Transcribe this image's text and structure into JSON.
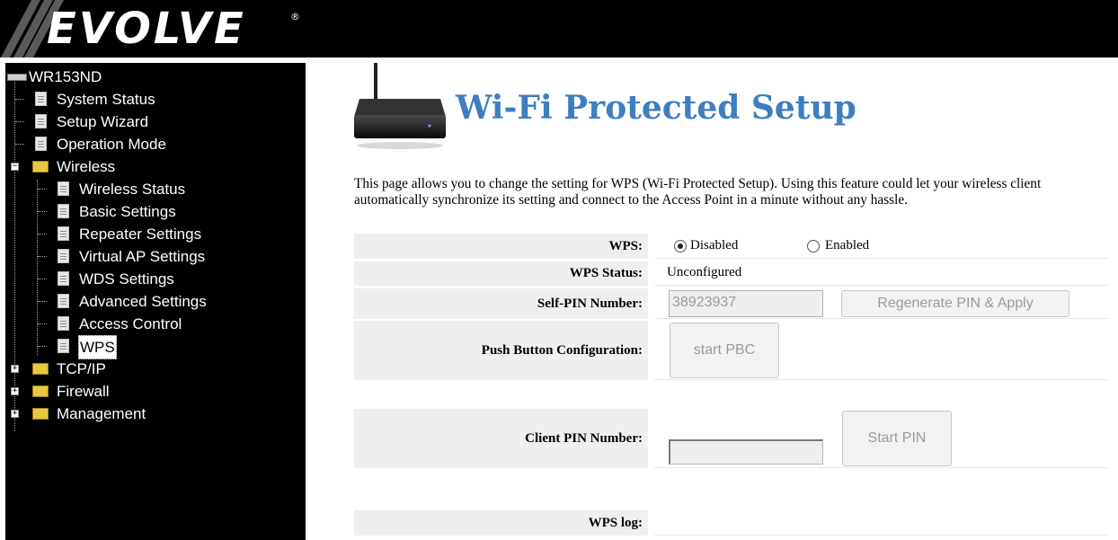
{
  "header": {
    "logo_text": "EVOLVE",
    "logo_mark": "®"
  },
  "sidebar": {
    "root_label": "WR153ND",
    "items": [
      {
        "label": "System Status",
        "icon": "page-icon"
      },
      {
        "label": "Setup Wizard",
        "icon": "page-icon"
      },
      {
        "label": "Operation Mode",
        "icon": "page-icon"
      },
      {
        "label": "Wireless",
        "icon": "folder-open-icon",
        "expanded": true
      },
      {
        "label": "Wireless Status",
        "icon": "page-icon"
      },
      {
        "label": "Basic Settings",
        "icon": "page-icon"
      },
      {
        "label": "Repeater Settings",
        "icon": "page-icon"
      },
      {
        "label": "Virtual AP Settings",
        "icon": "page-icon"
      },
      {
        "label": "WDS Settings",
        "icon": "page-icon"
      },
      {
        "label": "Advanced Settings",
        "icon": "page-icon"
      },
      {
        "label": "Access Control",
        "icon": "page-icon"
      },
      {
        "label": "WPS",
        "icon": "page-icon",
        "selected": true
      },
      {
        "label": "TCP/IP",
        "icon": "folder-icon",
        "expanded": false
      },
      {
        "label": "Firewall",
        "icon": "folder-icon",
        "expanded": false
      },
      {
        "label": "Management",
        "icon": "folder-icon",
        "expanded": false
      }
    ]
  },
  "main": {
    "title": "Wi-Fi Protected Setup",
    "description": "This page allows you to change the setting for WPS (Wi-Fi Protected Setup). Using this feature could let your wireless client automatically synchronize its setting and connect to the Access Point in a minute without any hassle.",
    "wps": {
      "label": "WPS:",
      "option_disabled": "Disabled",
      "option_enabled": "Enabled",
      "selected": "Disabled"
    },
    "status": {
      "label": "WPS Status:",
      "value": "Unconfigured"
    },
    "self_pin": {
      "label": "Self-PIN Number:",
      "value": "38923937",
      "button": "Regenerate PIN & Apply"
    },
    "pbc": {
      "label": "Push Button Configuration:",
      "button": "start PBC"
    },
    "client_pin": {
      "label": "Client PIN Number:",
      "value": "",
      "button": "Start PIN"
    },
    "log": {
      "label": "WPS log:"
    }
  },
  "colors": {
    "title": "#3d7ec0",
    "label_bg": "#efefef",
    "sidebar_bg": "#000000"
  }
}
